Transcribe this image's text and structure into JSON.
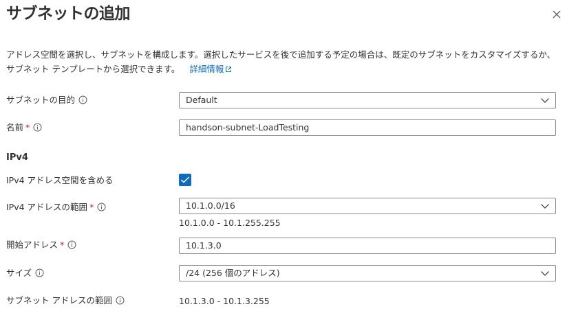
{
  "panel": {
    "title": "サブネットの追加",
    "description": "アドレス空間を選択し、サブネットを構成します。選択したサービスを後で追加する予定の場合は、既定のサブネットをカスタマイズするか、サブネット テンプレートから選択できます。",
    "learn_more_link": "詳細情報"
  },
  "form": {
    "purpose": {
      "label": "サブネットの目的",
      "value": "Default"
    },
    "name": {
      "label": "名前",
      "required_mark": "*",
      "value": "handson-subnet-LoadTesting"
    },
    "ipv4_section": {
      "heading": "IPv4"
    },
    "include_ipv4": {
      "label": "IPv4 アドレス空間を含める",
      "checked": true
    },
    "ipv4_range": {
      "label": "IPv4 アドレスの範囲",
      "required_mark": "*",
      "value": "10.1.0.0/16",
      "hint": "10.1.0.0 - 10.1.255.255"
    },
    "start_address": {
      "label": "開始アドレス",
      "required_mark": "*",
      "value": "10.1.3.0"
    },
    "size": {
      "label": "サイズ",
      "value": "/24 (256 個のアドレス)"
    },
    "subnet_range": {
      "label": "サブネット アドレスの範囲",
      "value": "10.1.3.0 - 10.1.3.255"
    }
  },
  "icons": {
    "close": "close-icon",
    "info": "info-icon",
    "external_link": "external-link-icon",
    "chevron": "chevron-down-icon",
    "check": "checkmark-icon"
  },
  "colors": {
    "accent": "#0f6cbd",
    "required": "#a4262c",
    "text": "#323130",
    "border": "#8a8886"
  }
}
